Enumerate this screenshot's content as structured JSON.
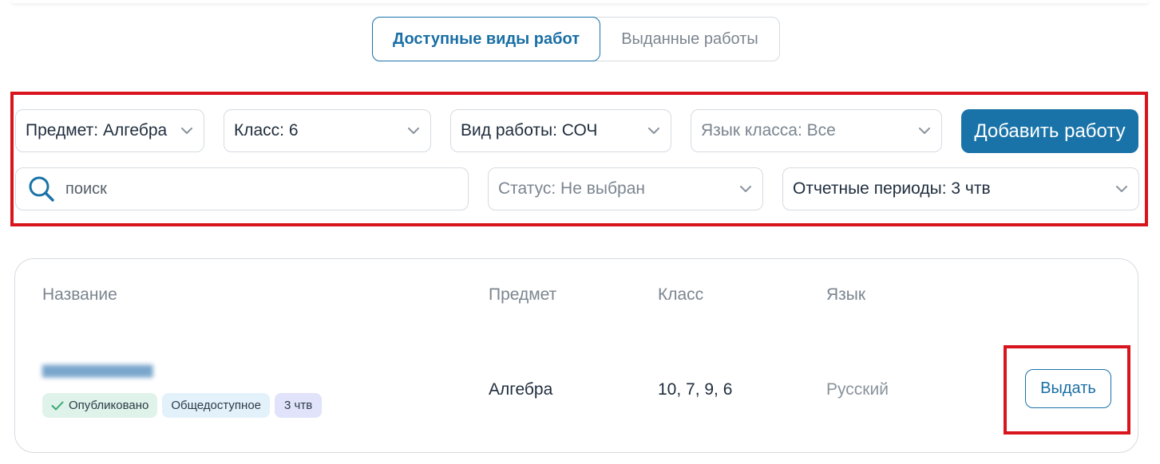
{
  "tabs": {
    "available_label": "Доступные виды работ",
    "issued_label": "Выданные работы"
  },
  "filters": {
    "subject": "Предмет: Алгебра",
    "grade": "Класс: 6",
    "work_type": "Вид работы: СОЧ",
    "class_language": "Язык класса: Все",
    "status": "Статус: Не выбран",
    "periods": "Отчетные периоды: 3 чтв",
    "add_button": "Добавить работу",
    "search_placeholder": "поиск"
  },
  "table": {
    "headers": {
      "name": "Название",
      "subject": "Предмет",
      "grade": "Класс",
      "language": "Язык"
    },
    "rows": [
      {
        "subject": "Алгебра",
        "grades": "10, 7, 9, 6",
        "language": "Русский",
        "badges": {
          "published": "Опубликовано",
          "public": "Общедоступное",
          "period": "3 чтв"
        },
        "action": "Выдать"
      }
    ]
  },
  "colors": {
    "accent": "#1a73a8",
    "highlight_frame": "#d8141c",
    "badge_green": "#e0f3ea",
    "badge_blue": "#e3f1fa",
    "badge_purple": "#e0e3fa"
  },
  "icons": {
    "search": "search-icon",
    "dropdown": "chevron-down-icon",
    "published": "check-icon"
  }
}
